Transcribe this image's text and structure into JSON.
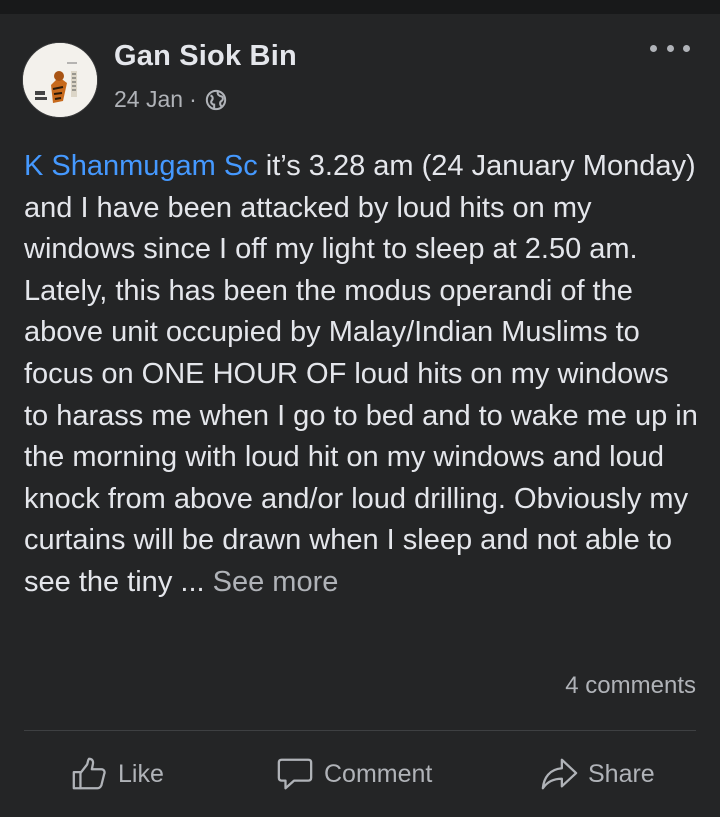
{
  "post": {
    "author": "Gan Siok Bin",
    "date": "24 Jan",
    "separator": "·",
    "privacy_icon": "globe-icon",
    "mention": "K Shanmugam Sc",
    "body": " it’s 3.28 am (24 January Monday) and I have been attacked by loud hits on my windows since I off my light to sleep at 2.50 am. Lately, this has been the modus operandi of the above unit occupied by Malay/Indian Muslims to focus on ONE HOUR OF loud hits on my windows to harass me when I go to bed and to wake me up in the morning with loud hit on my windows and loud knock from above and/or loud drilling. Obviously my curtains will be drawn when I sleep and not able to see the tiny",
    "truncation": " ... ",
    "see_more": "See more",
    "comments_count": "4 comments"
  },
  "actions": {
    "like": "Like",
    "comment": "Comment",
    "share": "Share"
  },
  "colors": {
    "background": "#18191a",
    "card": "#242526",
    "text": "#e4e6eb",
    "secondary": "#b0b3b8",
    "mention": "#4599ff"
  }
}
